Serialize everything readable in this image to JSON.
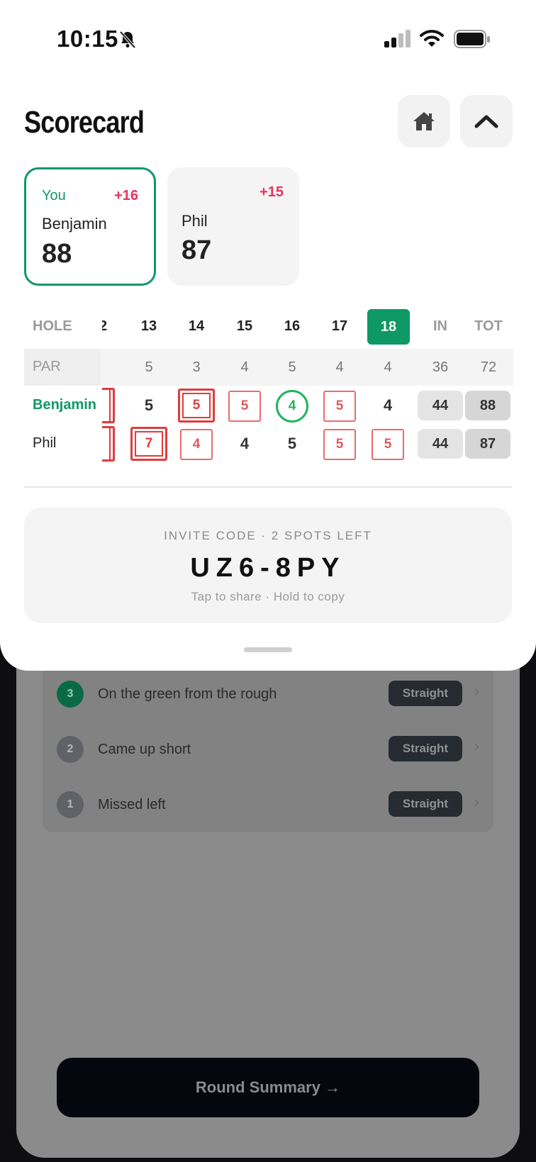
{
  "status": {
    "time": "10:15"
  },
  "header": {
    "title": "Scorecard"
  },
  "players": {
    "you": {
      "tag": "You",
      "diff": "+16",
      "name": "Benjamin",
      "score": "88"
    },
    "other": {
      "diff": "+15",
      "name": "Phil",
      "score": "87"
    }
  },
  "scorecard": {
    "hole_label": "HOLE",
    "par_label": "PAR",
    "partial_hole": "2",
    "holes": [
      "13",
      "14",
      "15",
      "16",
      "17",
      "18"
    ],
    "in_label": "IN",
    "tot_label": "TOT",
    "par": [
      "5",
      "3",
      "4",
      "5",
      "4",
      "4"
    ],
    "par_in": "36",
    "par_tot": "72",
    "rows": [
      {
        "name": "Benjamin",
        "scores": [
          "5",
          "5",
          "5",
          "4",
          "5",
          "4"
        ],
        "in": "44",
        "tot": "88"
      },
      {
        "name": "Phil",
        "scores": [
          "7",
          "4",
          "4",
          "5",
          "5",
          "5"
        ],
        "in": "44",
        "tot": "87"
      }
    ]
  },
  "invite": {
    "label": "INVITE CODE · 2 SPOTS LEFT",
    "code": "UZ6-8PY",
    "hint": "Tap to share · Hold to copy"
  },
  "shots": [
    {
      "num": "3",
      "text": "On the green from the rough",
      "pill": "Straight"
    },
    {
      "num": "2",
      "text": "Came up short",
      "pill": "Straight"
    },
    {
      "num": "1",
      "text": "Missed left",
      "pill": "Straight"
    }
  ],
  "summary_button": "Round Summary →",
  "colors": {
    "accent": "#109866",
    "over_par": "#e6335f",
    "bogey_box": "#ea6b6b",
    "birdie": "#22b35c"
  }
}
